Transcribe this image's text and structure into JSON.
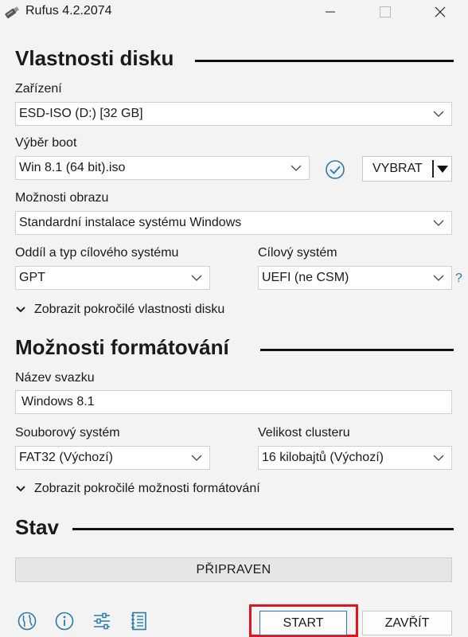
{
  "window": {
    "title": "Rufus 4.2.2074"
  },
  "drive_properties": {
    "heading": "Vlastnosti disku",
    "device": {
      "label": "Zařízení",
      "value": "ESD-ISO (D:) [32 GB]"
    },
    "boot": {
      "label": "Výběr boot",
      "value": "Win 8.1 (64 bit).iso",
      "select_button": "VYBRAT"
    },
    "image_option": {
      "label": "Možnosti obrazu",
      "value": "Standardní instalace systému Windows"
    },
    "partition_scheme": {
      "label": "Oddíl a typ cílového systému",
      "value": "GPT"
    },
    "target_system": {
      "label": "Cílový systém",
      "value": "UEFI (ne CSM)",
      "help": "?"
    },
    "advanced_toggle": "Zobrazit pokročilé vlastnosti disku"
  },
  "format_options": {
    "heading": "Možnosti formátování",
    "volume_label": {
      "label": "Název svazku",
      "value": "Windows 8.1"
    },
    "file_system": {
      "label": "Souborový systém",
      "value": "FAT32 (Výchozí)"
    },
    "cluster_size": {
      "label": "Velikost clusteru",
      "value": "16 kilobajtů (Výchozí)"
    },
    "advanced_toggle": "Zobrazit pokročilé možnosti formátování"
  },
  "status": {
    "heading": "Stav",
    "text": "PŘIPRAVEN"
  },
  "footer": {
    "icons": [
      "globe-icon",
      "info-icon",
      "settings-sliders-icon",
      "log-icon"
    ],
    "start_label": "START",
    "close_label": "ZAVŘÍT",
    "highlight_color": "#e0141e"
  },
  "colors": {
    "accent": "#2a7ab0",
    "background": "#f3f3f3"
  }
}
